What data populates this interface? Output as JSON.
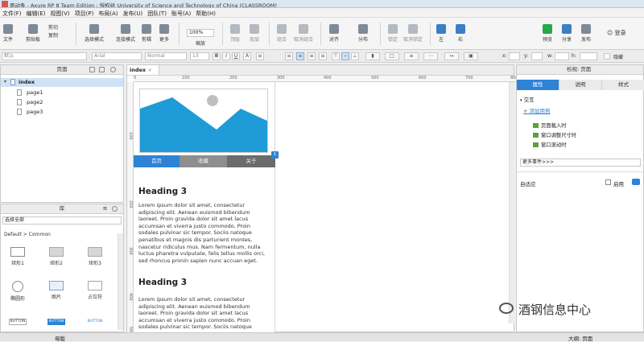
{
  "window": {
    "title": "原动条 - Axure RP 8 Team Edition : 授权给 University of Science and Technology of China (CLASSROOM)"
  },
  "menu": [
    "文件(F)",
    "编辑(E)",
    "视图(V)",
    "项目(P)",
    "布局(A)",
    "发布(U)",
    "团队(T)",
    "账号(A)",
    "帮助(H)"
  ],
  "toolbar": {
    "file_label": "文件",
    "clipboard": {
      "paste_label": "剪贴板",
      "cut": "剪切",
      "copy": "复制"
    },
    "select_mode": "选择模式",
    "connect_mode": "连接模式",
    "shrink": "剪辑",
    "more": "更多",
    "zoom_value": "100%",
    "zoom_label": "缩放",
    "top": "顶层",
    "bottom": "底层",
    "group": "组合",
    "ungroup": "取消组合",
    "align": "对齐",
    "distribute": "分布",
    "lock": "锁定",
    "unlock": "取消锁定",
    "left": "左",
    "right": "右",
    "preview": "预览",
    "share": "分享",
    "publish": "发布",
    "login": "登录"
  },
  "format_bar": {
    "style": "默认",
    "font": "Arial",
    "weight": "Normal",
    "size": "13",
    "x_label": "x:",
    "y_label": "y:",
    "w_label": "w:",
    "h_label": "h:",
    "hidden_label": "隐藏"
  },
  "pages_panel": {
    "title": "页面",
    "items": [
      {
        "label": "index"
      },
      {
        "label": "page1"
      },
      {
        "label": "page2"
      },
      {
        "label": "page3"
      }
    ]
  },
  "library_panel": {
    "title": "库",
    "select_all": "选择全部",
    "group": "Default > Common",
    "widgets": [
      {
        "label": "矩形1"
      },
      {
        "label": "矩形2"
      },
      {
        "label": "矩形3"
      },
      {
        "label": "椭圆形"
      },
      {
        "label": "图片"
      },
      {
        "label": "占位符"
      }
    ],
    "buttons": [
      "BUTTON",
      "BUTTON",
      "BUTTON"
    ]
  },
  "masters_label": "母版",
  "canvas": {
    "tab": "index",
    "ruler_h": [
      "0",
      "100",
      "200",
      "300",
      "400",
      "500",
      "600",
      "700",
      "800"
    ],
    "ruler_v": [
      "100",
      "200",
      "300",
      "400",
      "500"
    ],
    "nav": [
      {
        "label": "首页"
      },
      {
        "label": "收藏"
      },
      {
        "label": "关于"
      }
    ],
    "badge": "1",
    "sections": [
      {
        "heading": "Heading 3",
        "text": "Lorem ipsum dolor sit amet, consectetur adipiscing elit. Aenean euismod bibendum laoreet. Proin gravida dolor sit amet lacus accumsan et viverra justo commodo. Proin sodales pulvinar sic tempor. Sociis natoque penatibus et magnis dis parturient montes, nascetur ridiculus mus. Nam fermentum, nulla luctus pharetra vulputate, felis tellus mollis orci, sed rhoncus pronin sapien nunc accuan eget."
      },
      {
        "heading": "Heading 3",
        "text": "Lorem ipsum dolor sit amet, consectetur adipiscing elit. Aenean euismod bibendum laoreet. Proin gravida dolor sit amet lacus accumsan et viverra justo commodo. Proin sodales pulvinar sic tempor. Sociis natoque"
      }
    ]
  },
  "inspector": {
    "title": "检视: 页面",
    "tabs": [
      "属性",
      "说明",
      "样式"
    ],
    "interaction_label": "交互",
    "add_case": "添加用例",
    "events": [
      "页面载入时",
      "窗口调整尺寸时",
      "窗口滚动时"
    ],
    "more_events": "更多事件>>>",
    "adaptive_label": "自适应",
    "enable_label": "启用"
  },
  "outline_label": "大纲: 页面",
  "watermark": "酒钢信息中心",
  "colors": {
    "accent": "#2e83d6",
    "hero_fill": "#1f9bd7",
    "nav_bg": "#6b6b6b"
  }
}
